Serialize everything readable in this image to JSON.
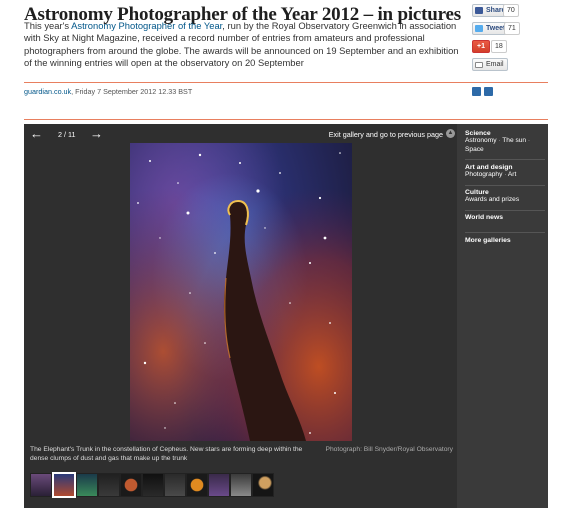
{
  "article": {
    "title": "Astronomy Photographer of the Year 2012 – in pictures",
    "standfirst_lead": "This year's ",
    "standfirst_link": "Astronomy Photographer of the Year",
    "standfirst_rest": ", run by the Royal Observatory Greenwich in association with Sky at Night Magazine, received a record number of entries from amateurs and professional photographers from around the globe. The awards will be announced on 19 September and an exhibition of the winning entries will open at the observatory on 20 September",
    "byline_source": "guardian.co.uk",
    "byline_date": ", Friday 7 September 2012 12.33 BST"
  },
  "share": {
    "facebook_label": "Share",
    "facebook_count": "70",
    "twitter_label": "Tweet",
    "twitter_count": "71",
    "google_label": "+1",
    "google_count": "18",
    "email_label": "Email"
  },
  "gallery": {
    "prev_icon": "left-arrow-icon",
    "next_icon": "right-arrow-icon",
    "counter": "2 / 11",
    "exit_label": "Exit gallery and go to previous page",
    "caption": "The Elephant's Trunk in the constellation of Cepheus. New stars are forming deep within the dense clumps of dust and gas that make up the trunk",
    "credit": "Photograph: Bill Snyder/Royal Observatory",
    "thumb_count": 11
  },
  "sidebar": {
    "sections": [
      {
        "heading": "Science",
        "links": [
          "Astronomy",
          "The sun",
          "Space"
        ]
      },
      {
        "heading": "Art and design",
        "links": [
          "Photography",
          "Art"
        ]
      },
      {
        "heading": "Culture",
        "links": [
          "Awards and prizes"
        ]
      },
      {
        "heading": "World news",
        "links": []
      },
      {
        "heading": "More galleries",
        "links": []
      }
    ]
  },
  "colors": {
    "accent_rule": "#e87f5f",
    "link": "#005689",
    "gallery_bg": "#3a3a3a"
  }
}
